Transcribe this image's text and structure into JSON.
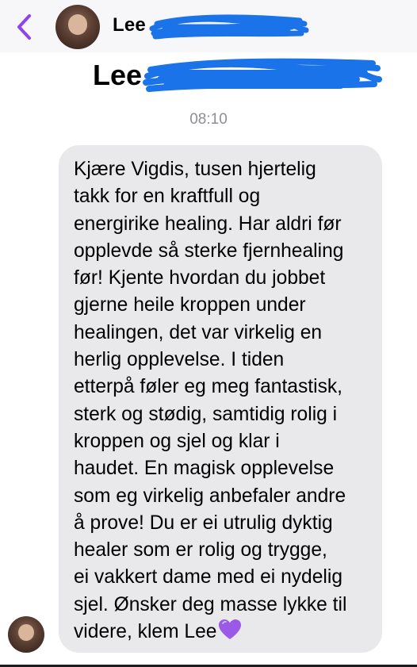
{
  "header": {
    "back_icon": "chevron-left-icon",
    "contact_name": "Lee"
  },
  "contact_card": {
    "name": "Lee"
  },
  "thread": {
    "timestamp": "08:10",
    "message": {
      "text": "Kjære Vigdis, tusen hjertelig\ntakk for en kraftfull og\nenergirike healing. Har aldri før\nopplevde så sterke fjernhealing\nfør! Kjente hvordan du jobbet\ngjerne heile kroppen under\nhealingen, det var virkelig en\nherlig opplevelse. I tiden\netterpå føler eg meg fantastisk,\nsterk og stødig, samtidig rolig i\nkroppen og sjel og klar i\nhaudet. En magisk opplevelse\nsom eg virkelig anbefaler andre\nå prove! Du er ei utrulig dyktig\nhealer som er rolig og trygge,\nei vakkert dame med ei nydelig\nsjel. Ønsker deg masse lykke til\nvidere, klem Lee",
      "emoji": "purple-heart-icon"
    }
  },
  "colors": {
    "accent": "#8e44ec",
    "redaction": "#1a73e8",
    "bubble": "#e9e9eb",
    "timestamp": "#8e8e93"
  }
}
